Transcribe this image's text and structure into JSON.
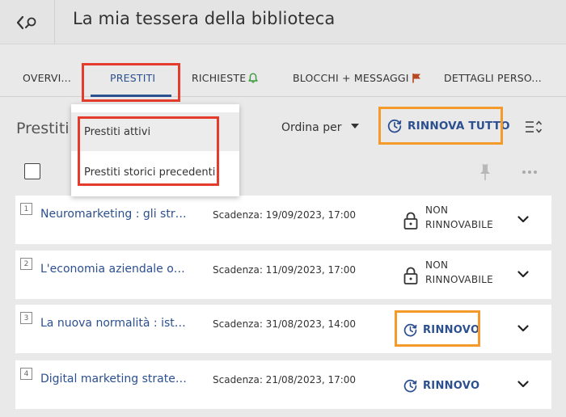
{
  "header": {
    "title": "La mia tessera della biblioteca",
    "back_icon": "chevron-left-icon",
    "search_icon": "search-icon"
  },
  "tabs": [
    {
      "label": "OVERVI...",
      "active": false
    },
    {
      "label": "PRESTITI",
      "active": true
    },
    {
      "label": "RICHIESTE",
      "active": false,
      "icon": "bell-icon",
      "icon_color": "#3a9a3a"
    },
    {
      "label": "BLOCCHI + MESSAGGI",
      "active": false,
      "icon": "flag-icon",
      "icon_color": "#b5481f"
    },
    {
      "label": "DETTAGLI PERSO...",
      "active": false
    }
  ],
  "loans": {
    "title": "Prestiti",
    "sort_label": "Ordina per",
    "renew_all_label": "RINNOVA TUTTO"
  },
  "dropdown": {
    "items": [
      "Prestiti attivi",
      "Prestiti storici precedenti"
    ]
  },
  "items": [
    {
      "num": "1",
      "title": "Neuromarketing : gli str…",
      "due": "Scadenza: 19/09/2023, 17:00",
      "status": [
        "NON",
        "RINNOVABILE"
      ],
      "renewable": false
    },
    {
      "num": "2",
      "title": "L'economia aziendale o…",
      "due": "Scadenza: 11/09/2023, 17:00",
      "status": [
        "NON",
        "RINNOVABILE"
      ],
      "renewable": false
    },
    {
      "num": "3",
      "title": "La nuova normalità : ist…",
      "due": "Scadenza: 31/08/2023, 14:00",
      "renew_label": "RINNOVO",
      "renewable": true
    },
    {
      "num": "4",
      "title": "Digital marketing strate…",
      "due": "Scadenza: 21/08/2023, 17:00",
      "renew_label": "RINNOVO",
      "renewable": true
    }
  ],
  "colors": {
    "accent": "#2b4f8f",
    "highlight_red": "#e53b2c",
    "highlight_orange": "#f39a2b"
  }
}
